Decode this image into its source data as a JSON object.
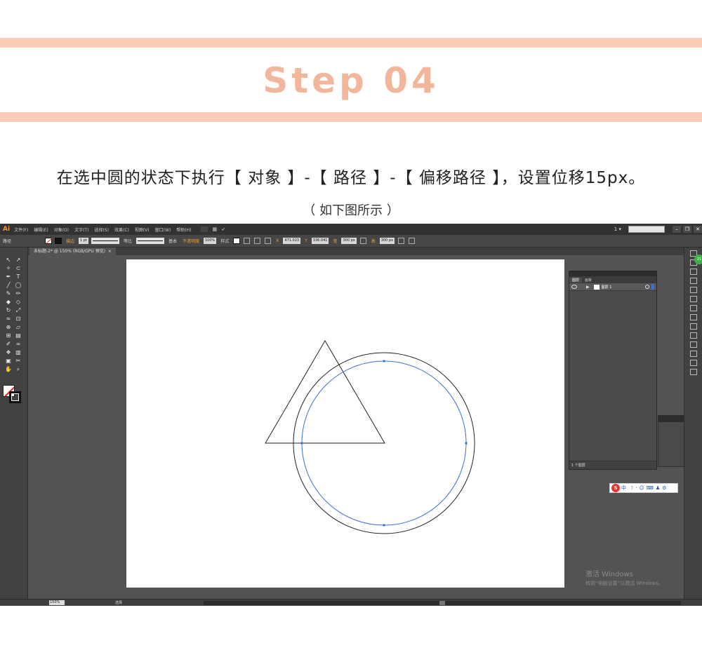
{
  "header": {
    "step_title": "Step 04",
    "instruction": "在选中圆的状态下执行【 对象 】-【 路径 】-【 偏移路径 】，设置位移15px。",
    "caption": "（ 如下图所示 ）"
  },
  "colors": {
    "band": "#f9cdb8",
    "step_title": "#f2b69b",
    "ui_dark": "#323232",
    "canvas_bg": "#535353",
    "selection_path": "#3b6fd6"
  },
  "app": {
    "logo": "Ai",
    "menus": [
      "文件(F)",
      "编辑(E)",
      "对象(O)",
      "文字(T)",
      "选择(S)",
      "效果(C)",
      "视图(V)",
      "窗口(W)",
      "帮助(H)"
    ],
    "page_indicator": "1 ▾",
    "window_buttons": [
      "–",
      "❐",
      "✕"
    ],
    "control_bar": {
      "object_type": "路径",
      "stroke_label": "描边",
      "stroke_weight": "1 pt",
      "profile_label": "等比",
      "brush_label": "基本",
      "opacity_label": "不透明度",
      "opacity_value": "100%",
      "style_label": "样式",
      "x_value": "471.023",
      "y_value": "336.041",
      "w_value": "300 px",
      "h_label": "高",
      "h_value": "300 px"
    },
    "document_tab": "未标题-2* @ 150% (RGB/GPU 预览)",
    "layers_panel": {
      "tabs": [
        "图层",
        "画板"
      ],
      "layer_name": "图层 1",
      "footer": "1 个图层"
    },
    "expand_label": "扩展",
    "ime": {
      "logo": "S",
      "mode": "中"
    },
    "watermark": {
      "line1": "激活 Windows",
      "line2": "转到“电脑设置”以激活 Windows。"
    },
    "status": {
      "zoom": "150%",
      "tool": "选择"
    },
    "badge": "21"
  }
}
